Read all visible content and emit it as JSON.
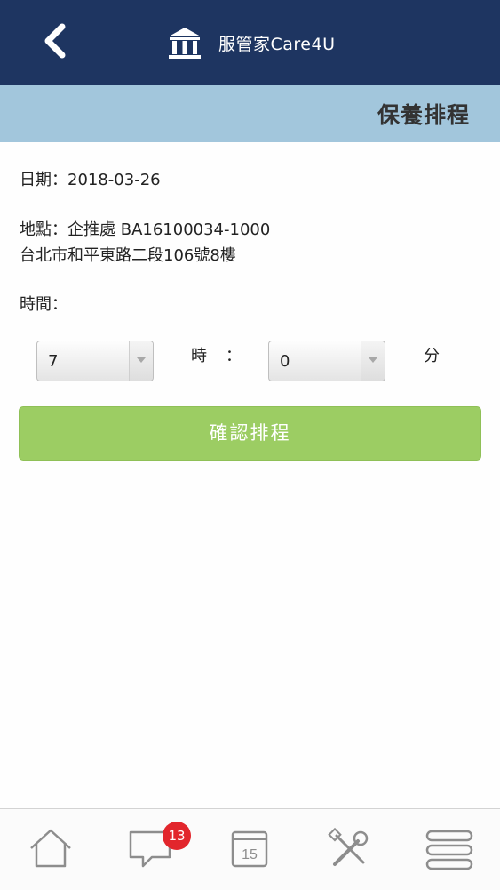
{
  "header": {
    "back_icon": "chevron-left-icon",
    "logo_icon": "bank-building-icon",
    "app_title": "服管家Care4U"
  },
  "subheader": {
    "title": "保養排程"
  },
  "info": {
    "date_line": "日期：2018-03-26",
    "location_line1": "地點：企推處 BA16100034-1000",
    "location_line2": "台北市和平東路二段106號8樓",
    "time_label": "時間："
  },
  "time_picker": {
    "hour_value": "7",
    "hour_unit": "時",
    "separator": "：",
    "minute_value": "0",
    "minute_unit": "分"
  },
  "confirm_button": {
    "label": "確認排程"
  },
  "tabbar": {
    "items": [
      {
        "icon": "home-icon"
      },
      {
        "icon": "chat-icon",
        "badge": "13"
      },
      {
        "icon": "calendar-icon",
        "calendar_day": "15"
      },
      {
        "icon": "tools-icon"
      },
      {
        "icon": "menu-icon"
      }
    ]
  },
  "colors": {
    "header_bg": "#1e3561",
    "subheader_bg": "#a2c6dc",
    "confirm_bg": "#9ccd63",
    "badge_bg": "#e2262c",
    "icon_gray": "#8d8d8d"
  }
}
